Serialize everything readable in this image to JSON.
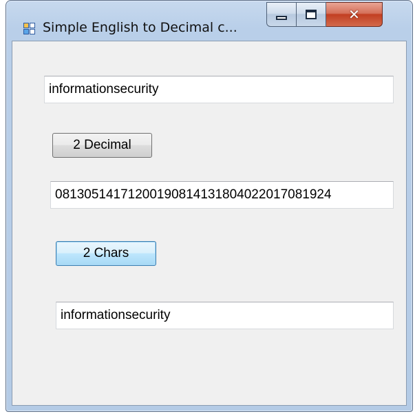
{
  "window": {
    "title": "Simple English to Decimal c..."
  },
  "form": {
    "input_text": "informationsecurity",
    "to_decimal_button": "2 Decimal",
    "decimal_output": "08130514171200190814131804022017081924",
    "to_chars_button": "2 Chars",
    "chars_output": "informationsecurity"
  },
  "colors": {
    "client_background": "#f0f0f0",
    "close_button": "#c23f22",
    "focus_border": "#3c7fb1"
  },
  "icons": {
    "app": "windows-form-icon",
    "minimize": "minimize-icon",
    "maximize": "maximize-icon",
    "close": "close-icon"
  }
}
